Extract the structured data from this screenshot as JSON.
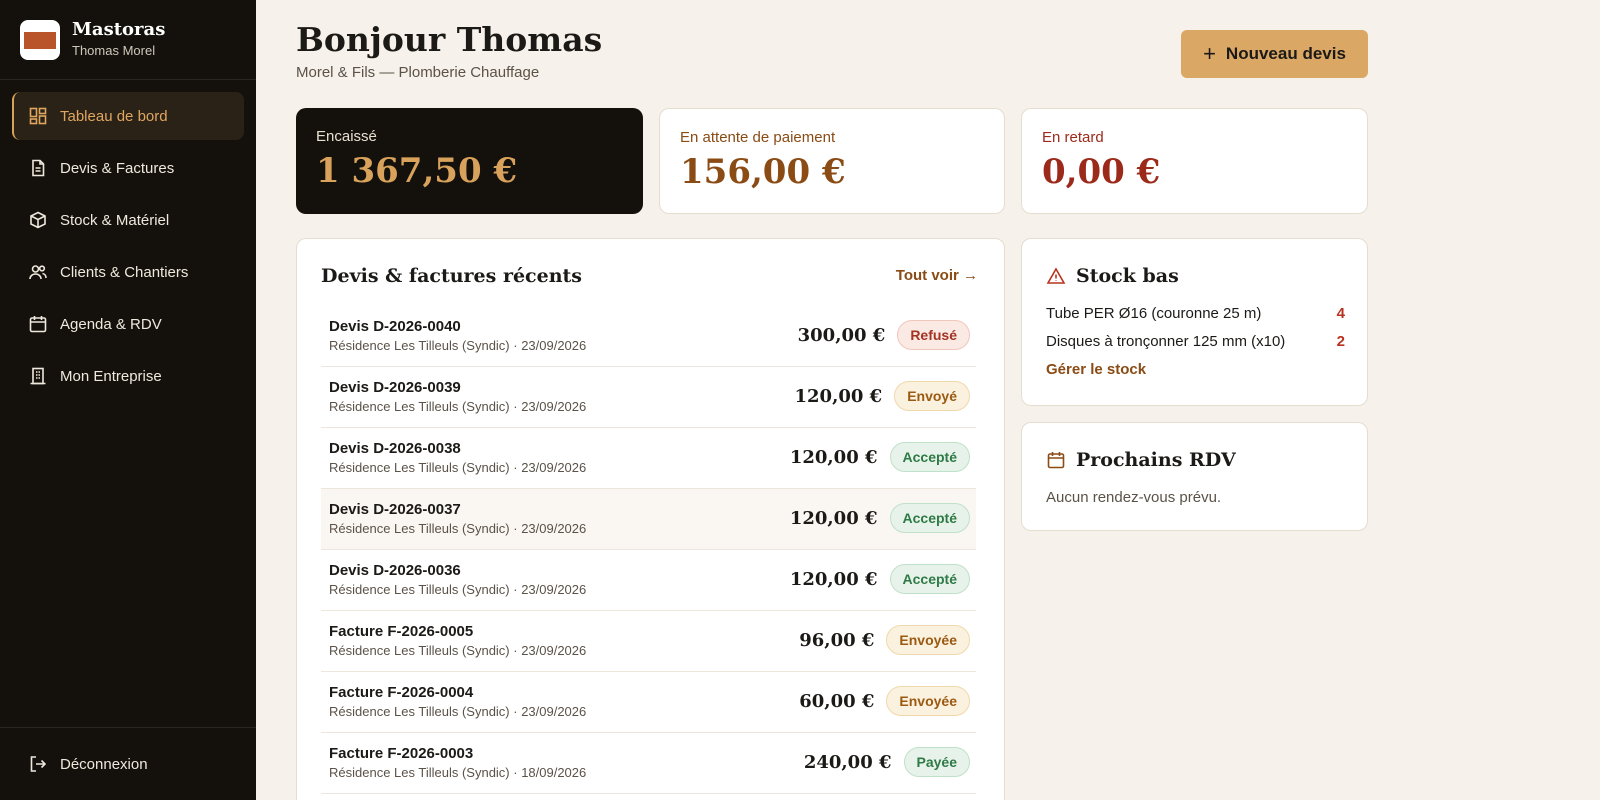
{
  "brand": {
    "name": "Mastoras",
    "user": "Thomas Morel"
  },
  "nav": [
    {
      "label": "Tableau de bord",
      "icon": "dashboard-icon",
      "active": true
    },
    {
      "label": "Devis & Factures",
      "icon": "document-icon"
    },
    {
      "label": "Stock & Matériel",
      "icon": "box-icon"
    },
    {
      "label": "Clients & Chantiers",
      "icon": "users-icon"
    },
    {
      "label": "Agenda & RDV",
      "icon": "calendar-icon"
    },
    {
      "label": "Mon Entreprise",
      "icon": "building-icon"
    }
  ],
  "logout_label": "Déconnexion",
  "header": {
    "title": "Bonjour Thomas",
    "subtitle": "Morel & Fils — Plomberie Chauffage",
    "new_button": "Nouveau devis"
  },
  "kpis": {
    "collected": {
      "label": "Encaissé",
      "value": "1 367,50 €"
    },
    "pending": {
      "label": "En attente de paiement",
      "value": "156,00 €"
    },
    "late": {
      "label": "En retard",
      "value": "0,00 €"
    }
  },
  "recent": {
    "title": "Devis & factures récents",
    "see_all": "Tout voir",
    "rows": [
      {
        "title": "Devis D-2026-0040",
        "sub": "Résidence Les Tilleuls (Syndic) · 23/09/2026",
        "amount": "300,00 €",
        "status": "Refusé",
        "status_type": "refuse"
      },
      {
        "title": "Devis D-2026-0039",
        "sub": "Résidence Les Tilleuls (Syndic) · 23/09/2026",
        "amount": "120,00 €",
        "status": "Envoyé",
        "status_type": "sent"
      },
      {
        "title": "Devis D-2026-0038",
        "sub": "Résidence Les Tilleuls (Syndic) · 23/09/2026",
        "amount": "120,00 €",
        "status": "Accepté",
        "status_type": "accepted"
      },
      {
        "title": "Devis D-2026-0037",
        "sub": "Résidence Les Tilleuls (Syndic) · 23/09/2026",
        "amount": "120,00 €",
        "status": "Accepté",
        "status_type": "accepted"
      },
      {
        "title": "Devis D-2026-0036",
        "sub": "Résidence Les Tilleuls (Syndic) · 23/09/2026",
        "amount": "120,00 €",
        "status": "Accepté",
        "status_type": "accepted"
      },
      {
        "title": "Facture F-2026-0005",
        "sub": "Résidence Les Tilleuls (Syndic) · 23/09/2026",
        "amount": "96,00 €",
        "status": "Envoyée",
        "status_type": "sent"
      },
      {
        "title": "Facture F-2026-0004",
        "sub": "Résidence Les Tilleuls (Syndic) · 23/09/2026",
        "amount": "60,00 €",
        "status": "Envoyée",
        "status_type": "sent"
      },
      {
        "title": "Facture F-2026-0003",
        "sub": "Résidence Les Tilleuls (Syndic) · 18/09/2026",
        "amount": "240,00 €",
        "status": "Payée",
        "status_type": "paid"
      }
    ]
  },
  "stock": {
    "title": "Stock bas",
    "items": [
      {
        "name": "Tube PER Ø16 (couronne 25 m)",
        "count": "4"
      },
      {
        "name": "Disques à tronçonner 125 mm (x10)",
        "count": "2"
      }
    ],
    "manage": "Gérer le stock"
  },
  "rdv": {
    "title": "Prochains RDV",
    "empty": "Aucun rendez-vous prévu."
  },
  "colors": {
    "sidebar_bg": "#14110c",
    "accent": "#dba765",
    "page_bg": "#f6f1ea"
  }
}
